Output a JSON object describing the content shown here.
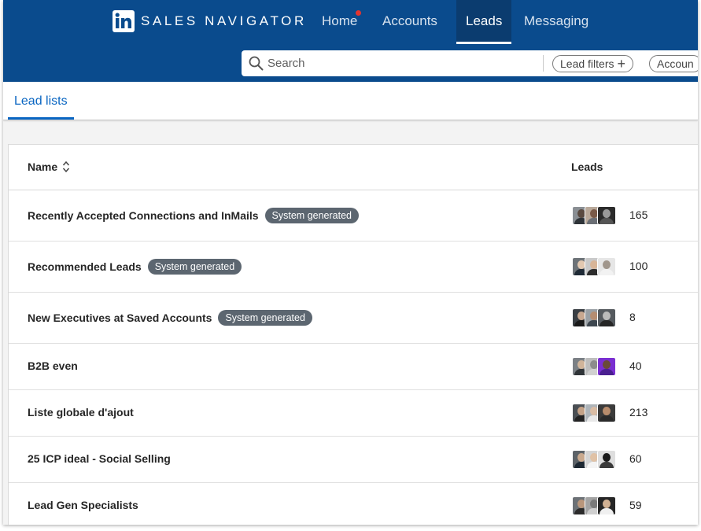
{
  "brand": {
    "name": "SALES NAVIGATOR"
  },
  "nav": {
    "items": [
      {
        "label": "Home",
        "notification": true
      },
      {
        "label": "Accounts"
      },
      {
        "label": "Leads",
        "active": true
      },
      {
        "label": "Messaging"
      }
    ]
  },
  "search": {
    "placeholder": "Search",
    "filters": [
      {
        "label": "Lead filters"
      },
      {
        "label": "Accoun"
      }
    ]
  },
  "tabs": [
    {
      "label": "Lead lists",
      "active": true
    }
  ],
  "table": {
    "columns": {
      "name": "Name",
      "leads": "Leads"
    },
    "rows": [
      {
        "name": "Recently Accepted Connections and InMails",
        "badge": "System generated",
        "count": "165"
      },
      {
        "name": "Recommended Leads",
        "badge": "System generated",
        "count": "100"
      },
      {
        "name": "New Executives at Saved Accounts",
        "badge": "System generated",
        "count": "8"
      },
      {
        "name": "B2B even",
        "count": "40"
      },
      {
        "name": "Liste globale d'ajout",
        "count": "213"
      },
      {
        "name": "25 ICP ideal - Social Selling",
        "count": "60"
      },
      {
        "name": "Lead Gen Specialists",
        "count": "59"
      }
    ]
  },
  "colors": {
    "nav_bg": "#0a4b8d",
    "nav_active_bg": "#0b3c6f",
    "accent": "#0a66c2",
    "badge_bg": "#5c6670",
    "notification": "#e3342f"
  }
}
